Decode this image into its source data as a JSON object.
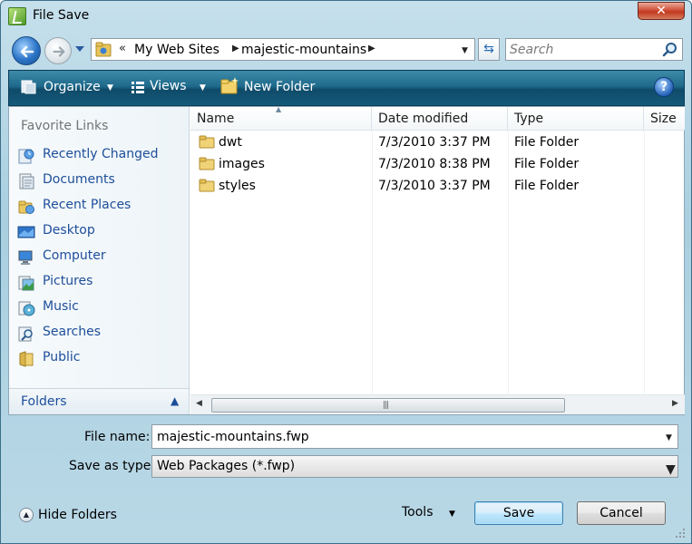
{
  "window": {
    "title": "File Save",
    "close_label": "✕"
  },
  "address": {
    "overflow": "«",
    "crumbs": [
      "My Web Sites",
      "majestic-mountains"
    ]
  },
  "search": {
    "placeholder": "Search"
  },
  "toolbar": {
    "organize_label": "Organize",
    "views_label": "Views",
    "new_folder_label": "New Folder",
    "help_label": "?"
  },
  "sidebar": {
    "header": "Favorite Links",
    "items": [
      {
        "label": "Recently Changed",
        "icon": "recently-changed-icon"
      },
      {
        "label": "Documents",
        "icon": "documents-icon"
      },
      {
        "label": "Recent Places",
        "icon": "recent-places-icon"
      },
      {
        "label": "Desktop",
        "icon": "desktop-icon"
      },
      {
        "label": "Computer",
        "icon": "computer-icon"
      },
      {
        "label": "Pictures",
        "icon": "pictures-icon"
      },
      {
        "label": "Music",
        "icon": "music-icon"
      },
      {
        "label": "Searches",
        "icon": "searches-icon"
      },
      {
        "label": "Public",
        "icon": "public-folder-icon"
      }
    ],
    "folders_label": "Folders"
  },
  "files": {
    "columns": [
      "Name",
      "Date modified",
      "Type",
      "Size"
    ],
    "rows": [
      {
        "name": "dwt",
        "date": "7/3/2010 3:37 PM",
        "type": "File Folder"
      },
      {
        "name": "images",
        "date": "7/3/2010 8:38 PM",
        "type": "File Folder"
      },
      {
        "name": "styles",
        "date": "7/3/2010 3:37 PM",
        "type": "File Folder"
      }
    ]
  },
  "form": {
    "filename_label": "File name:",
    "filename_value": "majestic-mountains.fwp",
    "savetype_label": "Save as type:",
    "savetype_value": "Web Packages (*.fwp)"
  },
  "footer": {
    "hide_folders_label": "Hide Folders",
    "tools_label": "Tools",
    "save_label": "Save",
    "cancel_label": "Cancel"
  },
  "colors": {
    "link": "#1e4e9a",
    "toolbar": "#1f6a8c",
    "close": "#c0391f"
  }
}
